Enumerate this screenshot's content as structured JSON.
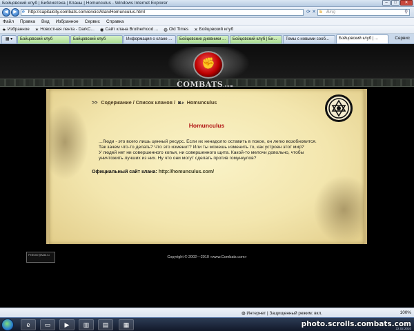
{
  "window": {
    "title": "Бойцовский клуб | Библиотека | Кланы | Homunculus - Windows Internet Explorer"
  },
  "address": {
    "url": "http://capitalcity.combats.com/encicl/klan/Homunculus.html",
    "search_placeholder": "Bing"
  },
  "menu": [
    "Файл",
    "Правка",
    "Вид",
    "Избранное",
    "Сервис",
    "Справка"
  ],
  "favorites": {
    "label": "Избранное",
    "items": [
      "Новостная лента - DarkC...",
      "Сайт клана Brotherhood ...",
      "Old Times",
      "Бойцовский клуб"
    ]
  },
  "tabs": [
    {
      "label": "Бойцовский клуб",
      "style": "grn"
    },
    {
      "label": "Бойцовский клуб",
      "style": "grn"
    },
    {
      "label": "Информация о клане ...",
      "style": "blu"
    },
    {
      "label": "Бойцовские дневники ...",
      "style": "grn"
    },
    {
      "label": "Бойцовский клуб | Би...",
      "style": "grn"
    },
    {
      "label": "Темы с новыми сооб...",
      "style": "blu"
    },
    {
      "label": "Бойцовский клуб | ...",
      "style": "act"
    }
  ],
  "toolbar": {
    "tools_label": "Сервис"
  },
  "site": {
    "logo_text": "COMBATS",
    "logo_suffix": ".com",
    "breadcrumb": {
      "prefix": ">>",
      "contents": "Содержание",
      "clans": "Список кланов",
      "current": "Homunculus",
      "sep": "/"
    },
    "clan_title": "Homunculus",
    "body_lines": [
      "...Люди - это всего лишь ценный ресурс. Если их ненадолго оставить в покое, он легко возобновится. Так зачем что-то делать? Что это изменит? Или ты можешь изменить то, как устроен этот мир?",
      "У людей нет ни совершенного копья, ни совершенного щита. Какой-то мелочи довольно, чтобы уничтожить лучших из них. Ну что они могут сделать против гомункулов?"
    ],
    "site_label": "Официальный сайт клана:",
    "site_url": "http://homunculus.com/",
    "copyright": "Copyright © 2002—2010 «www.Combats.com»",
    "counter_text": "Рейтинг@Mail.ru"
  },
  "status": {
    "zone": "Интернет | Защищенный режим: вкл.",
    "zoom": "100%"
  },
  "taskbar": {
    "watermark": "photo.scrolls.combats.com",
    "date": "22.02.2010"
  }
}
